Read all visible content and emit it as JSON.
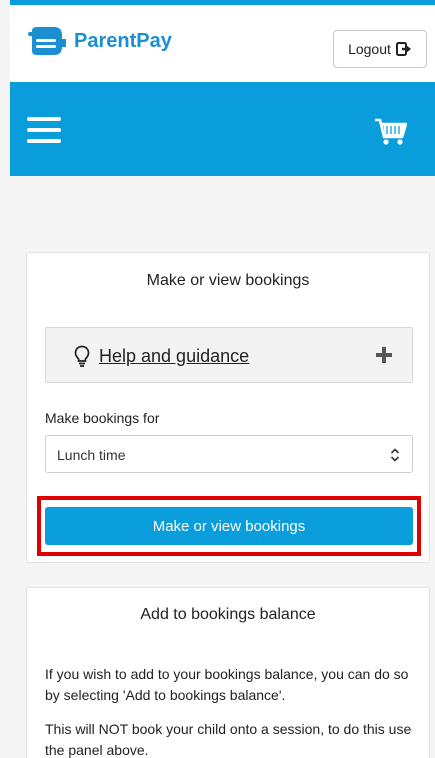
{
  "header": {
    "logo_text": "ParentPay",
    "logout_label": "Logout",
    "brand_color": "#0a9ddb"
  },
  "nav": {
    "menu_icon": "hamburger-icon",
    "cart_icon": "cart-icon"
  },
  "bookings_panel": {
    "title": "Make or view bookings",
    "help_link": "Help and guidance",
    "field_label": "Make bookings for",
    "selected_option": "Lunch time",
    "button_label": "Make or view bookings",
    "highlight_color": "#e00000"
  },
  "balance_panel": {
    "title": "Add to bookings balance",
    "paragraph1": "If you wish to add to your bookings balance, you can do so by selecting 'Add to bookings balance'.",
    "paragraph2": "This will NOT book your child onto a session, to do this use the panel above."
  }
}
